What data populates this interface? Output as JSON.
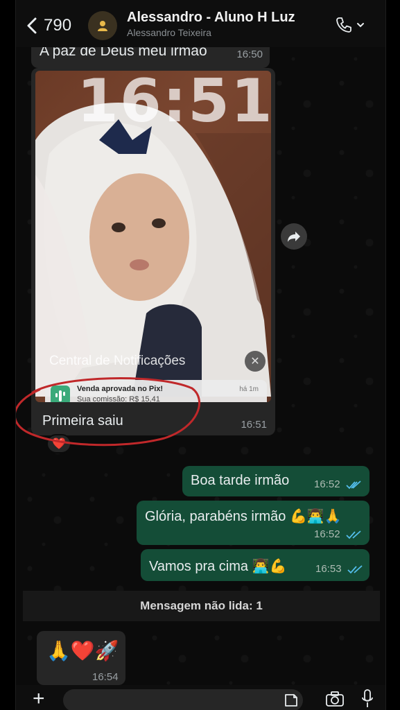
{
  "header": {
    "back_count": "790",
    "contact_name": "Alessandro - Aluno H Luz",
    "contact_subtitle": "Alessandro Teixeira"
  },
  "messages": {
    "top": {
      "text": "A paz de Deus meu irmão",
      "time": "16:50"
    },
    "image": {
      "clock": "16:51",
      "notification_center": "Central de Notificações",
      "notification_title": "Venda aprovada no Pix!",
      "notification_body": "Sua comissão: R$ 15,41",
      "notification_time": "há 1m",
      "caption": "Primeira saiu",
      "time": "16:51",
      "reaction": "❤️"
    },
    "out": [
      {
        "text": "Boa tarde irmão",
        "time": "16:52"
      },
      {
        "text": "Glória, parabéns irmão 💪👨‍💻🙏",
        "time": "16:52"
      },
      {
        "text": "Vamos pra cima 👨‍💻💪",
        "time": "16:53"
      }
    ],
    "unread_label": "Mensagem não lida: 1",
    "last": {
      "emojis": "🙏❤️🚀",
      "time": "16:54"
    }
  },
  "colors": {
    "incoming_bubble": "#262626",
    "outgoing_bubble": "#144d37",
    "read_ticks": "#53bdeb",
    "annotation_ring": "#c0282a"
  }
}
